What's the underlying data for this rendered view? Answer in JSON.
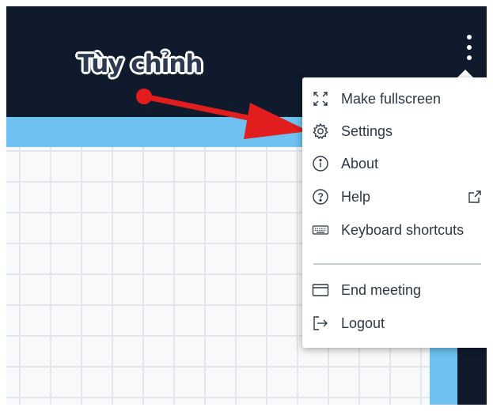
{
  "annotation": {
    "text": "Tùy chỉnh",
    "color": "#e11d1d"
  },
  "colors": {
    "header_bg": "#0f1b2d",
    "whiteboard_border": "#6ec1f0",
    "menu_text": "#2e3845"
  },
  "options_menu": {
    "button_icon": "vertical-ellipsis-icon",
    "items": [
      {
        "label": "Make fullscreen",
        "icon": "fullscreen-icon"
      },
      {
        "label": "Settings",
        "icon": "gear-icon"
      },
      {
        "label": "About",
        "icon": "info-icon"
      },
      {
        "label": "Help",
        "icon": "help-icon",
        "trailing_icon": "external-link-icon"
      },
      {
        "label": "Keyboard shortcuts",
        "icon": "keyboard-icon"
      },
      {
        "label": "End meeting",
        "icon": "window-icon"
      },
      {
        "label": "Logout",
        "icon": "logout-icon"
      }
    ]
  }
}
